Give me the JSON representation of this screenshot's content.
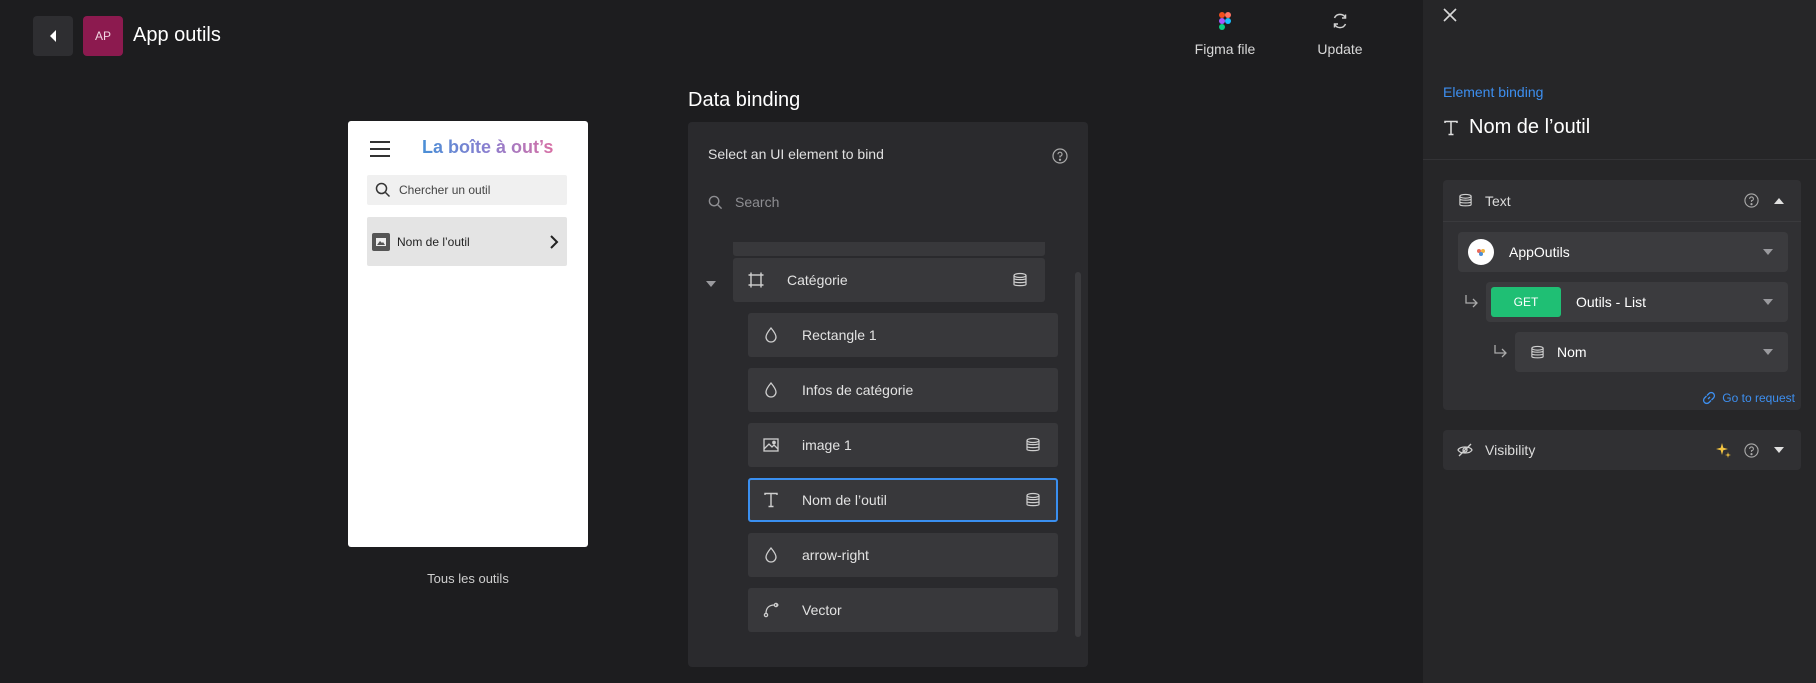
{
  "header": {
    "avatar_initials": "AP",
    "app_title": "App outils",
    "figma_label": "Figma file",
    "update_label": "Update"
  },
  "preview": {
    "brand": "La boîte à out’s",
    "search_placeholder": "Chercher un outil",
    "item_label": "Nom de l’outil",
    "caption": "Tous les outils"
  },
  "data_binding": {
    "title": "Data binding",
    "subtitle": "Select an UI element to bind",
    "search_placeholder": "Search",
    "parent": {
      "label": "Catégorie",
      "icon": "frame-icon",
      "bound": true
    },
    "children": [
      {
        "label": "Rectangle 1",
        "icon": "drop-icon",
        "bound": false,
        "selected": false
      },
      {
        "label": "Infos de catégorie",
        "icon": "drop-icon",
        "bound": false,
        "selected": false
      },
      {
        "label": "image 1",
        "icon": "image-icon",
        "bound": true,
        "selected": false
      },
      {
        "label": "Nom de l’outil",
        "icon": "text-icon",
        "bound": true,
        "selected": true
      },
      {
        "label": "arrow-right",
        "icon": "drop-icon",
        "bound": false,
        "selected": false
      },
      {
        "label": "Vector",
        "icon": "vector-icon",
        "bound": false,
        "selected": false
      }
    ]
  },
  "element_binding": {
    "link_label": "Element binding",
    "element_name": "Nom de l’outil",
    "text_section": {
      "label": "Text",
      "source": "AppOutils",
      "method": "GET",
      "request": "Outils - List",
      "field": "Nom",
      "goto_label": "Go to request"
    },
    "visibility_label": "Visibility"
  },
  "colors": {
    "accent": "#3d8ff0",
    "get_badge": "#1fbf74",
    "avatar_bg": "#8c1a4f",
    "selected_outline": "#3a8ff0"
  }
}
